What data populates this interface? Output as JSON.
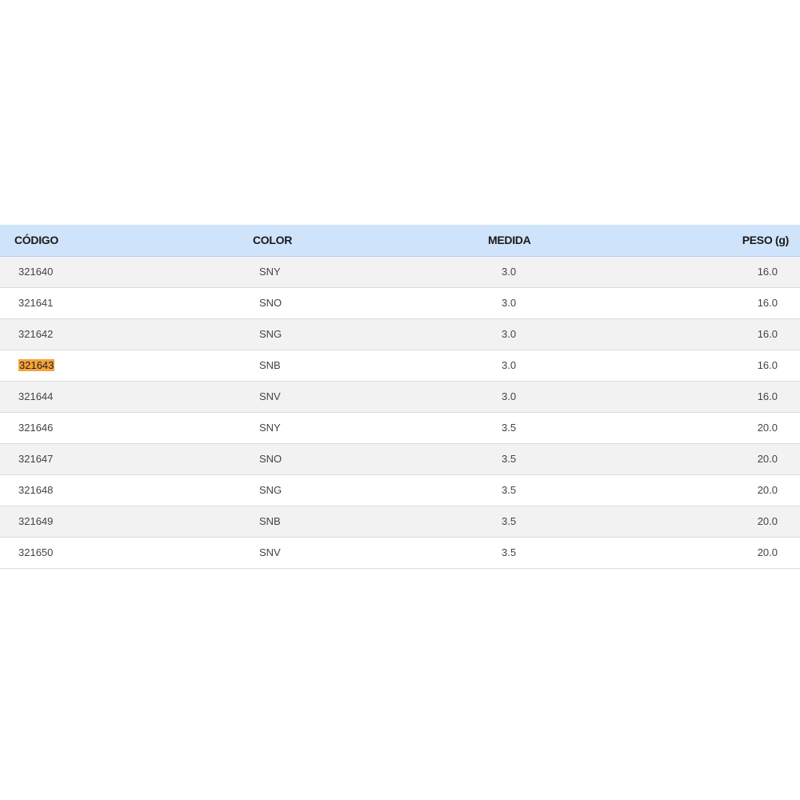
{
  "table": {
    "headers": {
      "code": "CÓDIGO",
      "color": "COLOR",
      "size": "MEDIDA",
      "weight": "PESO (g)"
    },
    "rows": [
      {
        "code": "321640",
        "color": "SNY",
        "size": "3.0",
        "weight": "16.0"
      },
      {
        "code": "321641",
        "color": "SNO",
        "size": "3.0",
        "weight": "16.0"
      },
      {
        "code": "321642",
        "color": "SNG",
        "size": "3.0",
        "weight": "16.0"
      },
      {
        "code": "321643",
        "color": "SNB",
        "size": "3.0",
        "weight": "16.0"
      },
      {
        "code": "321644",
        "color": "SNV",
        "size": "3.0",
        "weight": "16.0"
      },
      {
        "code": "321646",
        "color": "SNY",
        "size": "3.5",
        "weight": "20.0"
      },
      {
        "code": "321647",
        "color": "SNO",
        "size": "3.5",
        "weight": "20.0"
      },
      {
        "code": "321648",
        "color": "SNG",
        "size": "3.5",
        "weight": "20.0"
      },
      {
        "code": "321649",
        "color": "SNB",
        "size": "3.5",
        "weight": "20.0"
      },
      {
        "code": "321650",
        "color": "SNV",
        "size": "3.5",
        "weight": "20.0"
      }
    ],
    "highlighted_code": "321643"
  },
  "colors": {
    "header_background": "#cfe3fb",
    "stripe_background": "#f2f2f2",
    "highlight": "#f7a339"
  }
}
